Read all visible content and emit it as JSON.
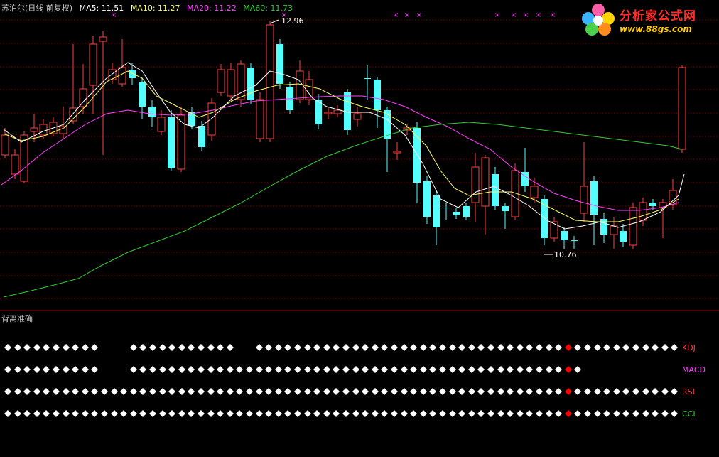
{
  "header": {
    "stock_name": "苏泊尔(日线 前复权)",
    "ma5": "MA5: 11.51",
    "ma10": "MA10: 11.27",
    "ma20": "MA20: 11.22",
    "ma60": "MA60: 11.73"
  },
  "colors": {
    "up": "#ff4040",
    "down": "#54ffff",
    "ma5": "#ffffff",
    "ma10": "#ffff66",
    "ma20": "#ff40ff",
    "ma60": "#33cc33",
    "grid": "#7a0000",
    "separator": "#aa0000",
    "marker": "#ff40ff",
    "diamond": "#ffffff",
    "signal": "#ff0000"
  },
  "watermark": {
    "title": "分析家公式网",
    "url": "www.88gs.com",
    "logo": "flower-logo"
  },
  "annotations": {
    "high": "12.96",
    "low": "10.76"
  },
  "lower_pane": {
    "title": "背离准确",
    "indicators": [
      {
        "name": "KDJ",
        "color": "#ff4040"
      },
      {
        "name": "MACD",
        "color": "#ff40ff"
      },
      {
        "name": "RSI",
        "color": "#ff4040"
      },
      {
        "name": "CCI",
        "color": "#33cc33"
      }
    ]
  }
}
